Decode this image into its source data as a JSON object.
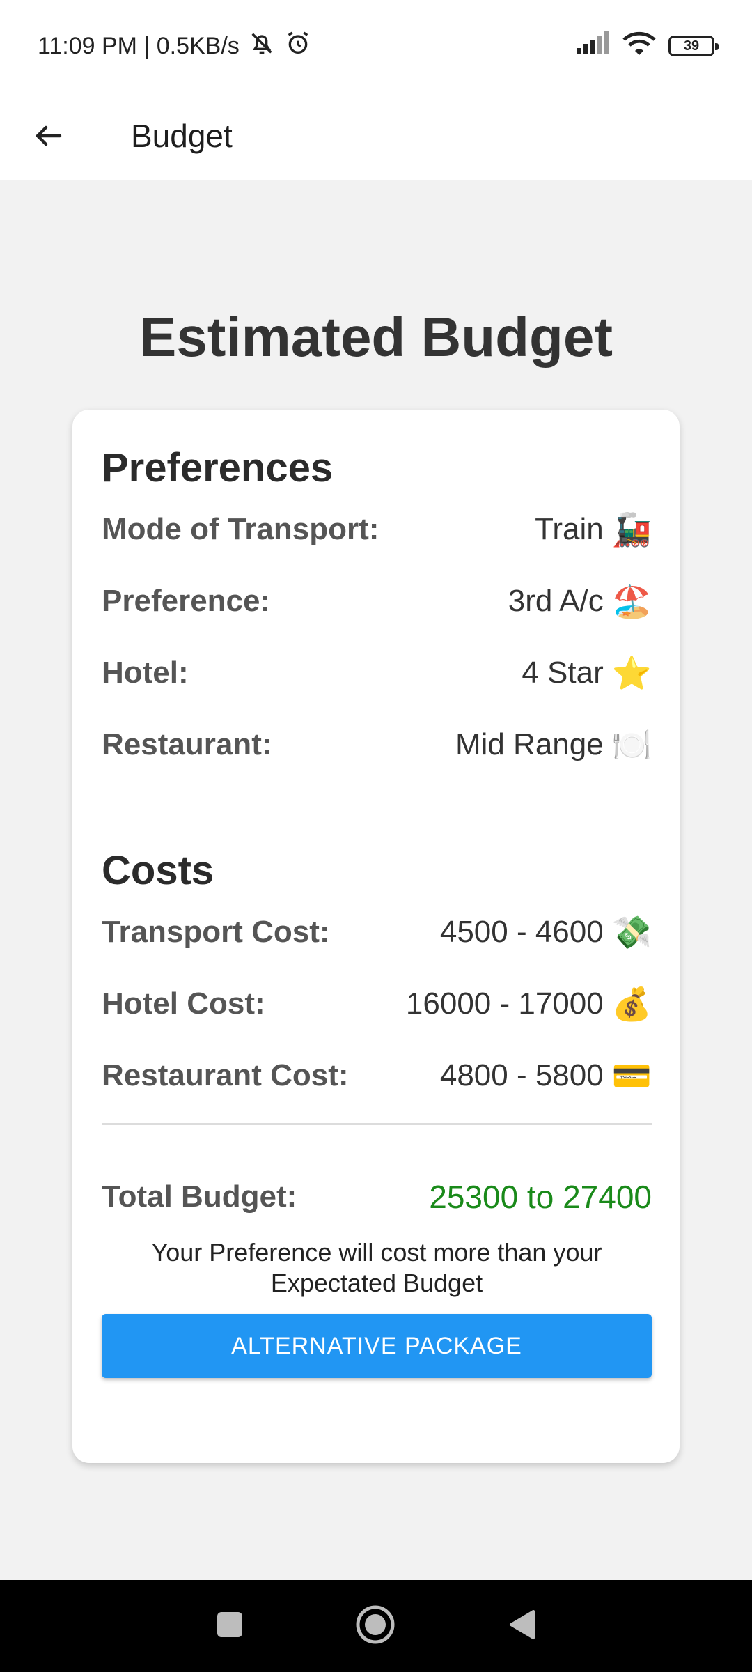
{
  "status_bar": {
    "time_speed": "11:09 PM | 0.5KB/s",
    "battery": "39"
  },
  "app_bar": {
    "title": "Budget"
  },
  "main": {
    "title": "Estimated Budget"
  },
  "preferences": {
    "heading": "Preferences",
    "rows": [
      {
        "label": "Mode of Transport:",
        "value": "Train",
        "emoji": "🚂"
      },
      {
        "label": "Preference:",
        "value": "3rd A/c",
        "emoji": "🏖️"
      },
      {
        "label": "Hotel:",
        "value": "4 Star",
        "emoji": "⭐"
      },
      {
        "label": "Restaurant:",
        "value": "Mid Range",
        "emoji": "🍽️"
      }
    ]
  },
  "costs": {
    "heading": "Costs",
    "rows": [
      {
        "label": "Transport Cost:",
        "value": "4500 - 4600",
        "emoji": "💸"
      },
      {
        "label": "Hotel Cost:",
        "value": "16000 - 17000",
        "emoji": "💰"
      },
      {
        "label": "Restaurant Cost:",
        "value": "4800 - 5800",
        "emoji": "💳"
      }
    ]
  },
  "total": {
    "label": "Total Budget:",
    "value": "25300 to 27400",
    "color": "#1a8a1a"
  },
  "note": "Your Preference will cost more than your Expectated Budget",
  "button": {
    "label": "ALTERNATIVE PACKAGE",
    "color": "#2196f3"
  }
}
